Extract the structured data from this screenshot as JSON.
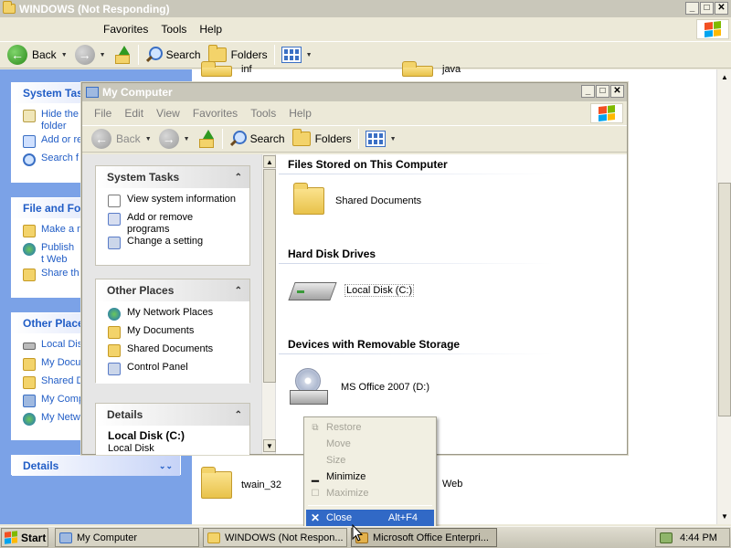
{
  "back_window": {
    "title": "WINDOWS (Not Responding)",
    "menu": [
      "Favorites",
      "Tools",
      "Help"
    ],
    "toolbar": {
      "back": "Back",
      "search": "Search",
      "folders": "Folders"
    },
    "panels": {
      "system_tasks": {
        "title": "System Tas",
        "items": [
          "Hide the folder",
          "Add or re",
          "Search f"
        ]
      },
      "file_folder": {
        "title": "File and Fol",
        "items": [
          "Make a n",
          "Publish t Web",
          "Share th"
        ]
      },
      "other_places": {
        "title": "Other Place",
        "items": [
          "Local Dis",
          "My Docu",
          "Shared D",
          "My Comp",
          "My Netw"
        ]
      },
      "details": {
        "title": "Details"
      }
    },
    "files": {
      "inf": "inf",
      "java": "java",
      "twain": "twain_32",
      "web": "Web"
    }
  },
  "my_computer": {
    "title": "My Computer",
    "menu": [
      "File",
      "Edit",
      "View",
      "Favorites",
      "Tools",
      "Help"
    ],
    "toolbar": {
      "back": "Back",
      "search": "Search",
      "folders": "Folders"
    },
    "system_tasks": {
      "title": "System Tasks",
      "items": [
        "View system information",
        "Add or remove programs",
        "Change a setting"
      ]
    },
    "other_places": {
      "title": "Other Places",
      "items": [
        "My Network Places",
        "My Documents",
        "Shared Documents",
        "Control Panel"
      ]
    },
    "details": {
      "title": "Details",
      "name": "Local Disk (C:)",
      "sub": "Local Disk"
    },
    "sections": {
      "stored": "Files Stored on This Computer",
      "hdd": "Hard Disk Drives",
      "removable": "Devices with Removable Storage"
    },
    "items": {
      "shared_docs": "Shared Documents",
      "local_disk": "Local Disk (C:)",
      "ms_office": "MS Office 2007 (D:)"
    }
  },
  "context_menu": {
    "restore": "Restore",
    "move": "Move",
    "size": "Size",
    "minimize": "Minimize",
    "maximize": "Maximize",
    "close": "Close",
    "close_accel": "Alt+F4"
  },
  "taskbar": {
    "start": "Start",
    "tasks": [
      "My Computer",
      "WINDOWS (Not Respon...",
      "Microsoft Office Enterpri..."
    ],
    "clock": "4:44 PM"
  },
  "colors": {
    "task_blue": "#215dc6",
    "highlight": "#3169c6",
    "flag_red": "#f25022",
    "flag_green": "#7fba00",
    "flag_blue": "#00a4ef",
    "flag_yellow": "#ffb900"
  },
  "icons": {
    "window_menu": "window-icon",
    "minimize": "minimize-icon",
    "maximize": "maximize-icon",
    "close": "close-icon"
  }
}
